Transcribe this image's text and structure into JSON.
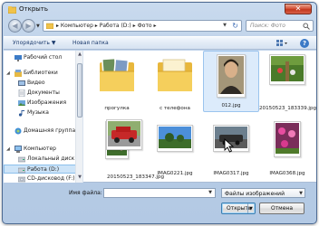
{
  "window": {
    "title": "Открыть",
    "close_glyph": "✕"
  },
  "nav": {
    "back_glyph": "◀",
    "forward_glyph": "▶",
    "dropdown_glyph": "▼",
    "address_path": "▸ Компьютер ▸ Работа (D:) ▸ Фото ▸",
    "address_dropdown_glyph": "▼",
    "refresh_glyph": "↻",
    "search_placeholder": "Поиск: Фото"
  },
  "toolbar": {
    "organize_label": "Упорядочить ▼",
    "new_folder_label": "Новая папка",
    "help_glyph": "?"
  },
  "sidebar": {
    "items": [
      {
        "label": "Рабочий стол",
        "icon": "desktop-icon"
      },
      {
        "label": "Библиотеки",
        "icon": "library-icon"
      },
      {
        "label": "Видео",
        "icon": "video-icon"
      },
      {
        "label": "Документы",
        "icon": "documents-icon"
      },
      {
        "label": "Изображения",
        "icon": "images-icon"
      },
      {
        "label": "Музыка",
        "icon": "music-icon"
      },
      {
        "label": "Домашняя группа",
        "icon": "homegroup-icon"
      },
      {
        "label": "Компьютер",
        "icon": "computer-icon"
      },
      {
        "label": "Локальный диск",
        "icon": "drive-icon"
      },
      {
        "label": "Работа (D:)",
        "icon": "drive-icon",
        "selected": true
      },
      {
        "label": "CD-дисковод (F:)",
        "icon": "cd-drive-icon"
      }
    ]
  },
  "files": [
    {
      "name": "прогулка",
      "type": "folder"
    },
    {
      "name": "с телефона",
      "type": "folder"
    },
    {
      "name": "012.jpg",
      "type": "portrait",
      "selected": true
    },
    {
      "name": "20150523_183339.jpg",
      "type": "garden"
    },
    {
      "name": "",
      "type": "flowers"
    },
    {
      "name": "",
      "type": "car"
    },
    {
      "name": "IMAG0221.jpg",
      "type": "landscape"
    },
    {
      "name": "IMAG0317.jpg",
      "type": "car2"
    },
    {
      "name": "IMAG0368.jpg",
      "type": "pink"
    },
    {
      "name": "20150523_183347.jpg",
      "type": "car"
    }
  ],
  "bottom": {
    "filename_label": "Имя файла:",
    "filename_value": "",
    "filter_label": "Файлы изображений",
    "open_label": "Открыть",
    "cancel_label": "Отмена",
    "dropdown_glyph": "▼"
  },
  "colors": {
    "window_frame": "#b8cde6",
    "selection": "#cde4f8",
    "close_button": "#c2361c",
    "folder_yellow": "#f2c94c"
  }
}
